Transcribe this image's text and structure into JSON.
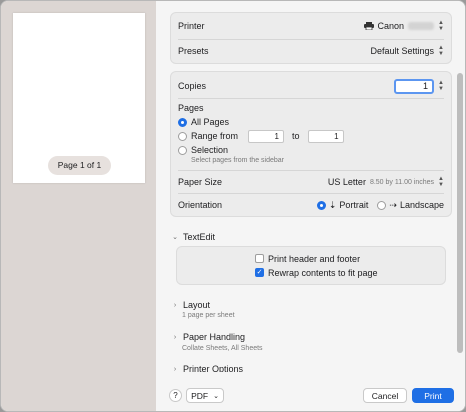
{
  "preview": {
    "page_indicator": "Page 1 of 1"
  },
  "printer": {
    "label": "Printer",
    "value": "Canon"
  },
  "presets": {
    "label": "Presets",
    "value": "Default Settings"
  },
  "copies": {
    "label": "Copies",
    "value": "1"
  },
  "pages": {
    "label": "Pages",
    "all_label": "All Pages",
    "range_label": "Range from",
    "range_from": "1",
    "range_to_label": "to",
    "range_to": "1",
    "selection_label": "Selection",
    "selection_hint": "Select pages from the sidebar"
  },
  "paper_size": {
    "label": "Paper Size",
    "value": "US Letter",
    "detail": "8.50 by 11.00 inches"
  },
  "orientation": {
    "label": "Orientation",
    "portrait": "Portrait",
    "landscape": "Landscape"
  },
  "textedit": {
    "title": "TextEdit",
    "option1": "Print header and footer",
    "option2": "Rewrap contents to fit page"
  },
  "layout": {
    "title": "Layout",
    "summary": "1 page per sheet"
  },
  "paper_handling": {
    "title": "Paper Handling",
    "summary": "Collate Sheets, All Sheets"
  },
  "printer_options": {
    "title": "Printer Options"
  },
  "footer": {
    "help": "?",
    "pdf": "PDF",
    "cancel": "Cancel",
    "print": "Print"
  },
  "colors": {
    "accent": "#1f6fe5",
    "preview_bg": "#dcd6d3"
  }
}
